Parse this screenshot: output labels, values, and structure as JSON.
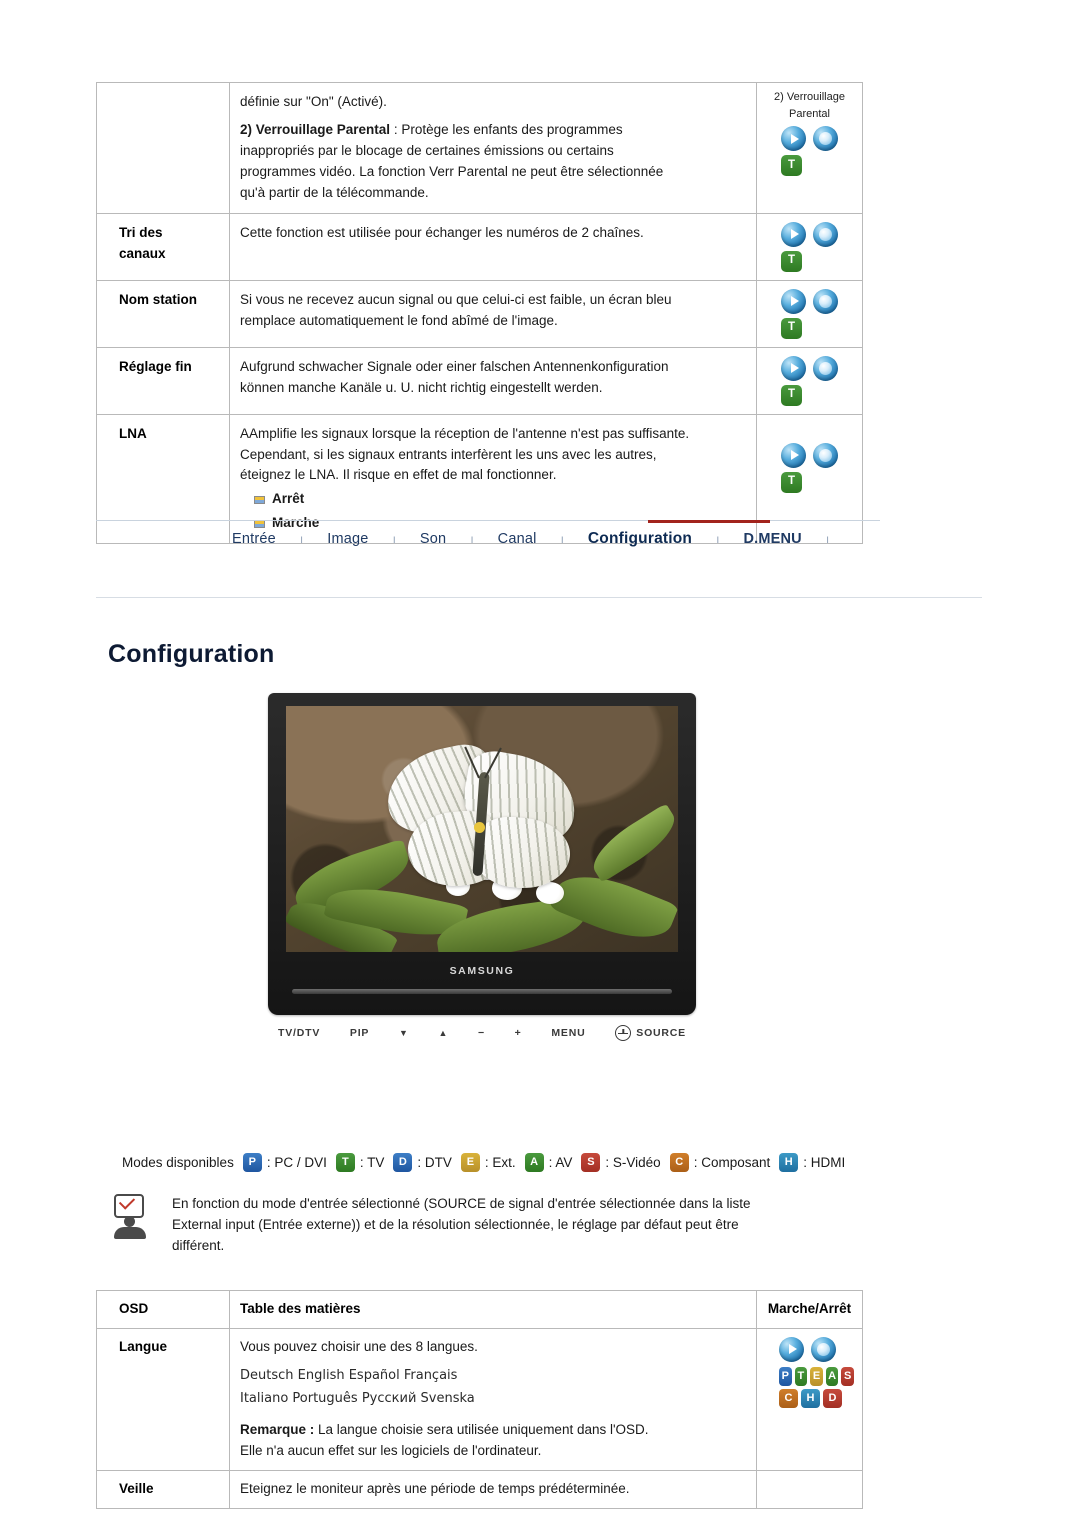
{
  "top_table": {
    "rows": [
      {
        "label": "",
        "desc_lines": [
          "définie sur \"On\" (Activé).",
          "2) Verrouillage Parental : Protège les enfants des programmes",
          "inappropriés par le blocage de certaines émissions ou certains",
          "programmes vidéo. La fonction Verr Parental ne peut être sélectionnée",
          "qu'à partir de la télécommande."
        ],
        "bold_prefix": "2) Verrouillage Parental",
        "icon_head": [
          "2) Verrouillage",
          "Parental"
        ],
        "icons": [
          "play-orb",
          "ball-orb",
          "T"
        ]
      },
      {
        "label": "Tri des canaux",
        "desc_lines": [
          "Cette fonction est utilisée pour échanger les numéros de 2 chaînes."
        ],
        "icons": [
          "play-orb",
          "ball-orb",
          "T"
        ]
      },
      {
        "label": "Nom station",
        "desc_lines": [
          "Si vous ne recevez aucun signal ou que celui-ci est faible, un écran bleu",
          "remplace automatiquement le fond abîmé de l'image."
        ],
        "icons": [
          "play-orb",
          "ball-orb",
          "T"
        ]
      },
      {
        "label": "Réglage fin",
        "desc_lines": [
          "Aufgrund schwacher Signale oder einer falschen Antennenkonfiguration",
          "können manche Kanäle u. U. nicht richtig eingestellt werden."
        ],
        "icons": [
          "play-orb",
          "ball-orb",
          "T"
        ]
      },
      {
        "label": "LNA",
        "desc_lines": [
          "AAmplifie les signaux lorsque la réception de l'antenne n'est pas suffisante.",
          "Cependant, si les signaux entrants interfèrent les uns avec les autres,",
          "éteignez le LNA. Il risque en effet de mal fonctionner."
        ],
        "bullets": [
          "Arrêt",
          "Marche"
        ],
        "icons": [
          "play-orb",
          "ball-orb",
          "T"
        ]
      }
    ]
  },
  "navbar": {
    "items": [
      {
        "label": "Entrée",
        "active": false
      },
      {
        "label": "Image",
        "active": false
      },
      {
        "label": "Son",
        "active": false
      },
      {
        "label": "Canal",
        "active": false
      },
      {
        "label": "Configuration",
        "active": true
      },
      {
        "label": "D.MENU",
        "active": false
      }
    ],
    "separator": "ı",
    "accent_color": "#a2231d"
  },
  "heading": "Configuration",
  "monitor": {
    "brand": "SAMSUNG",
    "controls": [
      "TV/DTV",
      "PIP",
      "▼",
      "▲",
      "−",
      "+",
      "MENU",
      "SOURCE"
    ]
  },
  "modes_line": {
    "prefix": "Modes disponibles",
    "items": [
      {
        "badge": "P",
        "color": "#2f66b5",
        "text": ": PC / DVI"
      },
      {
        "badge": "T",
        "color": "#3e8c33",
        "text": ": TV"
      },
      {
        "badge": "D",
        "color": "#2f66b5",
        "text": ": DTV"
      },
      {
        "badge": "E",
        "color": "#c9a330",
        "text": ": Ext."
      },
      {
        "badge": "A",
        "color": "#d08f22",
        "text": ": AV"
      },
      {
        "badge": "S",
        "color": "#b8392b",
        "text": ": S-Vidéo"
      },
      {
        "badge": "C",
        "color": "#c06a1c",
        "text": ": Composant"
      },
      {
        "badge": "H",
        "color": "#2f8fb5",
        "text": ": HDMI"
      }
    ]
  },
  "note": {
    "lines": [
      "En fonction du mode d'entrée sélectionné (SOURCE de signal d'entrée sélectionnée dans la liste",
      "External input (Entrée externe)) et de la résolution sélectionnée, le réglage par défaut peut être",
      "différent."
    ]
  },
  "bottom_table": {
    "headers": [
      "OSD",
      "Table des matières",
      "Marche/Arrêt"
    ],
    "rows": [
      {
        "label": "Langue",
        "desc": "Vous pouvez choisir une des 8 langues.",
        "languages_line1": "Deutsch  English  Español  Français",
        "languages_line2": "Italiano  Português  Русский  Svenska",
        "remark_bold": "Remarque :",
        "remark_rest": " La langue choisie sera utilisée uniquement dans l'OSD.",
        "remark_line2": "Elle n'a aucun effet sur les logiciels de l'ordinateur.",
        "icons_top": [
          "play-orb",
          "ball-orb"
        ],
        "mini_row1": [
          {
            "t": "P",
            "c": "#2f66b5"
          },
          {
            "t": "T",
            "c": "#3e8c33"
          },
          {
            "t": "E",
            "c": "#c9a330"
          },
          {
            "t": "A",
            "c": "#d08f22"
          },
          {
            "t": "S",
            "c": "#b8392b"
          }
        ],
        "mini_row2": [
          {
            "t": "C",
            "c": "#c06a1c"
          },
          {
            "t": "H",
            "c": "#2f8fb5"
          },
          {
            "t": "D",
            "c": "#b8392b"
          }
        ]
      },
      {
        "label": "Veille",
        "desc": "Eteignez le moniteur après une période de temps prédéterminée."
      }
    ]
  }
}
